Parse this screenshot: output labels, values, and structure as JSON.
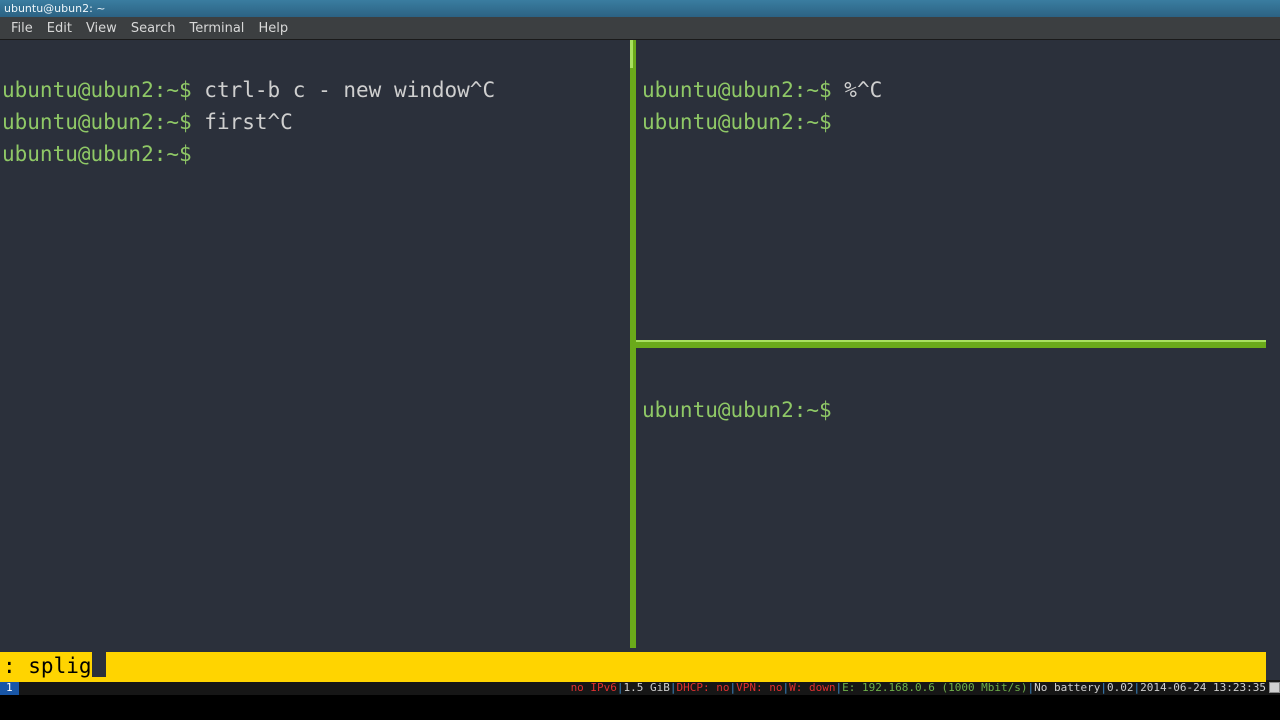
{
  "window": {
    "title": "ubuntu@ubun2: ~"
  },
  "menu": {
    "file": "File",
    "edit": "Edit",
    "view": "View",
    "search": "Search",
    "terminal": "Terminal",
    "help": "Help"
  },
  "prompt": "ubuntu@ubun2:~$ ",
  "panes": {
    "left": {
      "line1_cmd": "ctrl-b c - new window^C",
      "line2_cmd": "first^C",
      "line3_cmd": ""
    },
    "right_top": {
      "line1_cmd": "%^C",
      "line2_cmd": ""
    },
    "right_bottom": {
      "line1_cmd": ""
    }
  },
  "command_bar": {
    "text": ": splig"
  },
  "status": {
    "workspace": "1",
    "ipv6": "no IPv6",
    "mem": "1.5 GiB",
    "dhcp": "DHCP: no",
    "vpn": "VPN: no",
    "wlan": "W: down",
    "eth": "E: 192.168.0.6 (1000 Mbit/s)",
    "battery": "No battery",
    "load": "0.02",
    "date": "2014-06-24 13:23:35"
  }
}
